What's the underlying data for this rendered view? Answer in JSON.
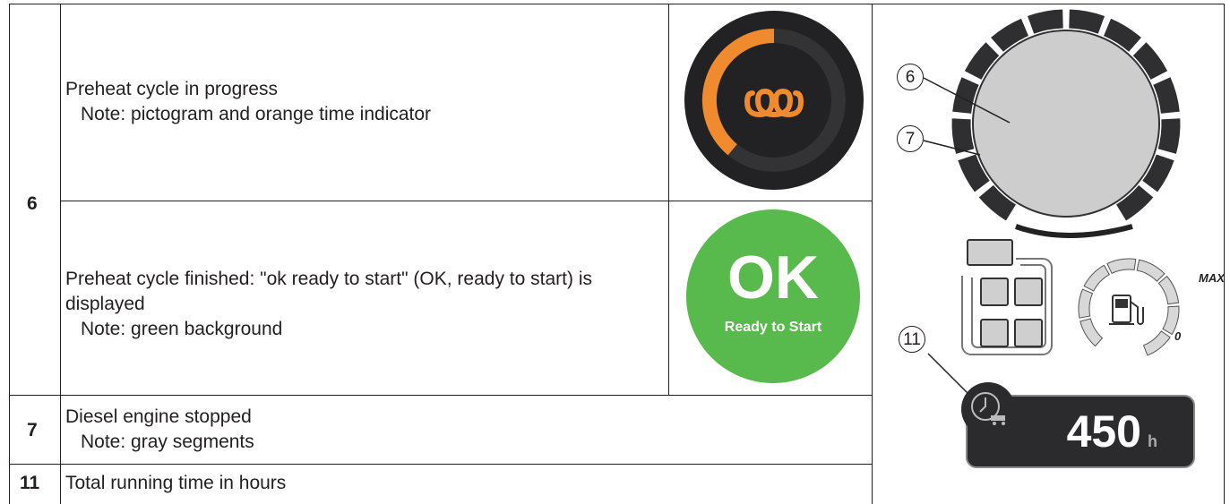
{
  "rows": [
    {
      "number": "6",
      "entries": [
        {
          "text": "Preheat cycle in progress",
          "note": "Note: pictogram and orange time indicator"
        },
        {
          "text": "Preheat cycle finished: \"ok ready to start\" (OK, ready to start) is displayed",
          "note": "Note: green background"
        }
      ]
    },
    {
      "number": "7",
      "text": "Diesel engine stopped",
      "note": "Note: gray segments"
    },
    {
      "number": "11",
      "text": "Total running time in hours"
    }
  ],
  "ok_display": {
    "big": "OK",
    "small": "Ready to Start"
  },
  "dashboard": {
    "callouts": [
      "6",
      "7",
      "11"
    ],
    "fuel_max": "MAX",
    "fuel_min": "0",
    "hours_value": "450",
    "hours_unit": "h",
    "preheat_progress": 0.5
  },
  "colors": {
    "orange": "#f08a2e",
    "green": "#58b94c",
    "dark": "#222224",
    "gray": "#c8c8c8"
  }
}
